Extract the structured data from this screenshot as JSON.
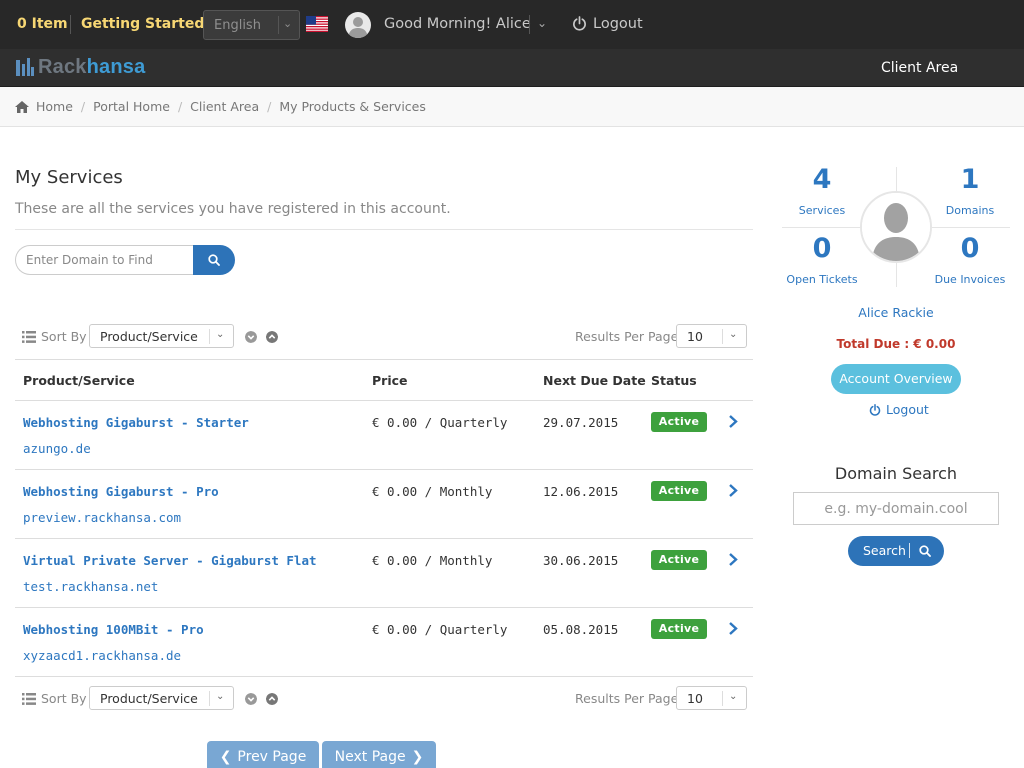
{
  "topbar": {
    "cart_label": "0 Item",
    "getting_started": "Getting Started",
    "language": "English",
    "greeting": "Good Morning! Alice",
    "logout": "Logout"
  },
  "brand": {
    "logo_part1": "Rack",
    "logo_part2": "hansa",
    "nav_client_area": "Client Area"
  },
  "breadcrumb": [
    "Home",
    "Portal Home",
    "Client Area",
    "My Products & Services"
  ],
  "main": {
    "title": "My Services",
    "description": "These are all the services you have registered in this account.",
    "search_placeholder": "Enter Domain to Find",
    "sort_label": "Sort By",
    "sort_value": "Product/Service",
    "rpp_label": "Results Per Page",
    "rpp_value": "10",
    "columns": [
      "Product/Service",
      "Price",
      "Next Due Date",
      "Status"
    ],
    "services": [
      {
        "name": "Webhosting Gigaburst - Starter",
        "domain": "azungo.de",
        "price": "€ 0.00 / Quarterly",
        "due": "29.07.2015",
        "status": "Active"
      },
      {
        "name": "Webhosting Gigaburst - Pro",
        "domain": "preview.rackhansa.com",
        "price": "€ 0.00 / Monthly",
        "due": "12.06.2015",
        "status": "Active"
      },
      {
        "name": "Virtual Private Server - Gigaburst Flat",
        "domain": "test.rackhansa.net",
        "price": "€ 0.00 / Monthly",
        "due": "30.06.2015",
        "status": "Active"
      },
      {
        "name": "Webhosting 100MBit - Pro",
        "domain": "xyzaacd1.rackhansa.de",
        "price": "€ 0.00 / Quarterly",
        "due": "05.08.2015",
        "status": "Active"
      }
    ],
    "prev_page": "Prev Page",
    "next_page": "Next Page"
  },
  "sidebar": {
    "stats": [
      {
        "value": "4",
        "label": "Services"
      },
      {
        "value": "1",
        "label": "Domains"
      },
      {
        "value": "0",
        "label": "Open Tickets"
      },
      {
        "value": "0",
        "label": "Due Invoices"
      }
    ],
    "user_name": "Alice Rackie",
    "total_due": "Total Due : € 0.00",
    "account_overview": "Account Overview",
    "logout": "Logout",
    "domain_search_title": "Domain Search",
    "domain_search_placeholder": "e.g. my-domain.cool",
    "domain_search_button": "Search"
  },
  "colors": {
    "accent": "#2d77c0",
    "button_primary": "#2d73b8",
    "button_info": "#5bc0de",
    "status_active": "#3da13d",
    "due_red": "#c0392b",
    "topbar_bg": "#282828"
  }
}
